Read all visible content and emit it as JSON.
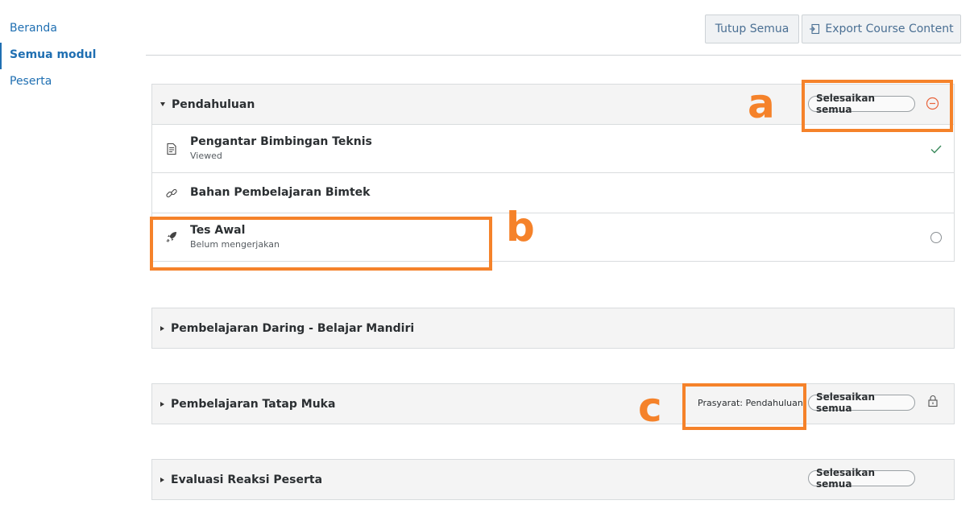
{
  "nav": {
    "items": [
      {
        "label": "Beranda"
      },
      {
        "label": "Semua modul"
      },
      {
        "label": "Peserta"
      }
    ]
  },
  "toolbar": {
    "close_all_label": "Tutup Semua",
    "export_label": "Export Course Content"
  },
  "sections": [
    {
      "title": "Pendahuluan",
      "expanded": true,
      "complete_all_label": "Selesaikan semua",
      "status_icon": "minus-circle-icon",
      "items": [
        {
          "title": "Pengantar Bimbingan Teknis",
          "subtitle": "Viewed",
          "icon": "page-icon",
          "status": "check-icon"
        },
        {
          "title": "Bahan Pembelajaran Bimtek",
          "subtitle": "",
          "icon": "link-icon",
          "status": ""
        },
        {
          "title": "Tes Awal",
          "subtitle": "Belum mengerjakan",
          "icon": "rocket-icon",
          "status": "empty-circle-icon"
        }
      ]
    },
    {
      "title": "Pembelajaran Daring - Belajar Mandiri",
      "expanded": false
    },
    {
      "title": "Pembelajaran Tatap Muka",
      "expanded": false,
      "prerequisite": "Prasyarat: Pendahuluan",
      "complete_all_label": "Selesaikan semua",
      "status_icon": "lock-icon"
    },
    {
      "title": "Evaluasi Reaksi Peserta",
      "expanded": false,
      "complete_all_label": "Selesaikan semua"
    }
  ],
  "annotations": {
    "a": "a",
    "b": "b",
    "c": "c",
    "color": "#f5822a"
  },
  "colors": {
    "link": "#1f6fb2",
    "check": "#3a8a5c",
    "minus": "#e8643c"
  }
}
